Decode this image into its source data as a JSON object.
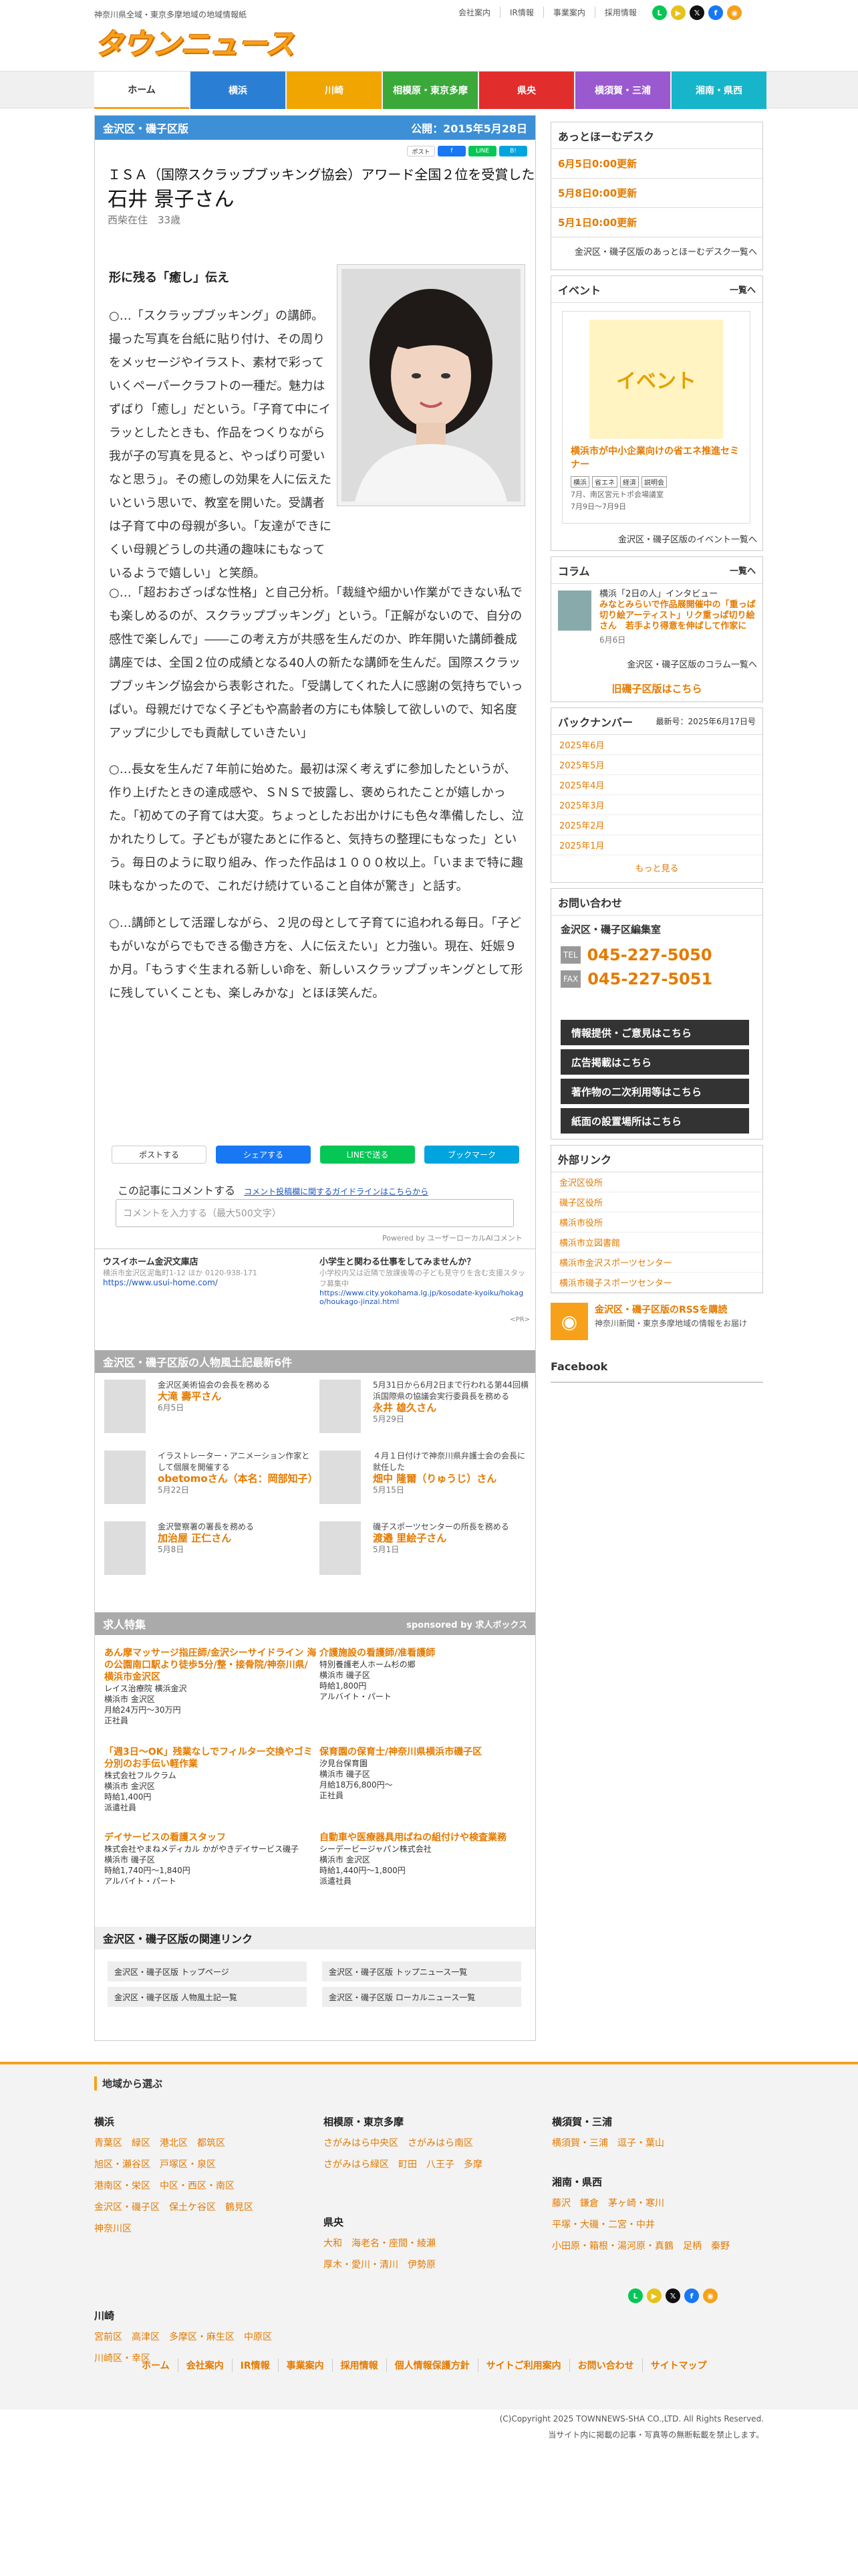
{
  "header": {
    "tagline": "神奈川県全域・東京多摩地域の地域情報紙",
    "logo": "タウンニュース",
    "top_links": [
      "会社案内",
      "IR情報",
      "事業案内",
      "採用情報"
    ],
    "social_icons": [
      "line-icon",
      "youtube-icon",
      "x-icon",
      "facebook-icon",
      "rss-icon"
    ]
  },
  "nav": {
    "tabs": [
      {
        "label": "ホーム",
        "color": "#ffffff",
        "text": "#333333"
      },
      {
        "label": "横浜",
        "color": "#2a7fd4",
        "text": "#ffffff"
      },
      {
        "label": "川崎",
        "color": "#f0a500",
        "text": "#ffffff"
      },
      {
        "label": "相模原・東京多摩",
        "color": "#3aa93a",
        "text": "#ffffff"
      },
      {
        "label": "県央",
        "color": "#e22d2d",
        "text": "#ffffff"
      },
      {
        "label": "横須賀・三浦",
        "color": "#9b59d0",
        "text": "#ffffff"
      },
      {
        "label": "湘南・県西",
        "color": "#17b5c9",
        "text": "#ffffff"
      }
    ]
  },
  "article": {
    "region": "金沢区・磯子区版",
    "published": "公開：2015年5月28日",
    "share_mini": [
      "ポスト",
      "f",
      "LINE",
      "B!"
    ],
    "subtitle": "ＩＳＡ（国際スクラップブッキング協会）アワード全国２位を受賞した",
    "name": "石井 景子さん",
    "meta": "西柴在住　33歳",
    "section_title": "形に残る「癒し」伝え",
    "paragraphs": [
      "○…「スクラップブッキング」の講師。撮った写真を台紙に貼り付け、その周りをメッセージやイラスト、素材で彩っていくペーパークラフトの一種だ。魅力はずばり「癒し」だという。「子育て中にイラッとしたときも、作品をつくりながら我が子の写真を見ると、やっぱり可愛いなと思う」。その癒しの効果を人に伝えたいという思いで、教室を開いた。受講者は子育て中の母親が多い。「友達ができにくい母親どうしの共通の趣味にもなっているようで嬉しい」と笑顔。",
      "○…「超おおざっぱな性格」と自己分析。「裁縫や細かい作業ができない私でも楽しめるのが、スクラップブッキング」という。「正解がないので、自分の感性で楽しんで」――この考え方が共感を生んだのか、昨年開いた講師養成講座では、全国２位の成績となる40人の新たな講師を生んだ。国際スクラップブッキング協会から表彰された。「受講してくれた人に感謝の気持ちでいっぱい。母親だけでなく子どもや高齢者の方にも体験して欲しいので、知名度アップに少しでも貢献していきたい」",
      "○…長女を生んだ７年前に始めた。最初は深く考えずに参加したというが、作り上げたときの達成感や、ＳＮＳで披露し、褒められたことが嬉しかった。「初めての子育ては大変。ちょっとしたお出かけにも色々準備したし、泣かれたりして。子どもが寝たあとに作ると、気持ちの整理にもなった」という。毎日のように取り組み、作った作品は１０００枚以上。「いままで特に趣味もなかったので、これだけ続けていること自体が驚き」と話す。",
      "○…講師として活躍しながら、２児の母として子育てに追われる毎日。「子どもがいながらでもできる働き方を、人に伝えたい」と力強い。現在、妊娠９か月。「もうすぐ生まれる新しい命を、新しいスクラップブッキングとして形に残していくことも、楽しみかな」とほほ笑んだ。"
    ],
    "share_buttons": [
      {
        "label": "ポストする",
        "color": "#ffffff",
        "text": "#333333"
      },
      {
        "label": "シェアする",
        "color": "#1877f2",
        "text": "#ffffff"
      },
      {
        "label": "LINEで送る",
        "color": "#06c755",
        "text": "#ffffff"
      },
      {
        "label": "ブックマーク",
        "color": "#00a4de",
        "text": "#ffffff"
      }
    ],
    "comment_label": "この記事にコメントする",
    "comment_guide": "コメント投稿欄に関するガイドラインはこちらから",
    "comment_placeholder": "コメントを入力する（最大500文字）",
    "powered_by": "Powered by ユーザーローカルAIコメント"
  },
  "ads": [
    {
      "title": "ウスイホーム金沢文庫店",
      "sub": "横浜市金沢区泥亀町1-12 ほか 0120-938-171",
      "url": "https://www.usui-home.com/"
    },
    {
      "title": "小学生と関わる仕事をしてみませんか？",
      "sub": "小学校内又は近隣で放課後等の子ども見守りを含む支援スタッフ募集中",
      "url": "https://www.city.yokohama.lg.jp/kosodate-kyoiku/hokago/houkago-jinzai.html"
    }
  ],
  "ads_pr": "<PR>",
  "people": {
    "header": "金沢区・磯子区版の人物風土記最新6件",
    "items": [
      {
        "desc": "金沢区美術協会の会長を務める",
        "name": "大滝 壽平さん",
        "date": "6月5日"
      },
      {
        "desc": "5月31日から6月2日まで行われる第44回横浜国際県の協議会実行委員長を務める",
        "name": "永井 雄久さん",
        "date": "5月29日"
      },
      {
        "desc": "イラストレーター・アニメーション作家として個展を開催する",
        "name": "obetomoさん（本名：岡部知子）",
        "date": "5月22日"
      },
      {
        "desc": "４月１日付けで神奈川県弁護士会の会長に就任した",
        "name": "畑中 隆爾（りゅうじ）さん",
        "date": "5月15日"
      },
      {
        "desc": "金沢警察署の署長を務める",
        "name": "加治屋 正仁さん",
        "date": "5月8日"
      },
      {
        "desc": "磯子スポーツセンターの所長を務める",
        "name": "渡邉 里絵子さん",
        "date": "5月1日"
      }
    ]
  },
  "jobs": {
    "header": "求人特集",
    "sponsor": "sponsored by 求人ボックス",
    "items": [
      {
        "title": "あん摩マッサージ指圧師/金沢シーサイドライン 海の公園南口駅より徒歩5分/整・接骨院/神奈川県/横浜市金沢区",
        "co": "レイス治療院 横浜金沢",
        "loc": "横浜市 金沢区",
        "pay": "月給24万円～30万円",
        "type": "正社員"
      },
      {
        "title": "介護施設の看護師/准看護師",
        "co": "特別養護老人ホーム杉の郷",
        "loc": "横浜市 磯子区",
        "pay": "時給1,800円",
        "type": "アルバイト・パート"
      },
      {
        "title": "「週3日～OK」残業なしでフィルター交換やゴミ分別のお手伝い軽作業",
        "co": "株式会社フルクラム",
        "loc": "横浜市 金沢区",
        "pay": "時給1,400円",
        "type": "派遣社員"
      },
      {
        "title": "保育園の保育士/神奈川県横浜市磯子区",
        "co": "汐見台保育園",
        "loc": "横浜市 磯子区",
        "pay": "月給18万6,800円～",
        "type": "正社員"
      },
      {
        "title": "デイサービスの看護スタッフ",
        "co": "株式会社やまねメディカル かがやきデイサービス磯子",
        "loc": "横浜市 磯子区",
        "pay": "時給1,740円～1,840円",
        "type": "アルバイト・パート"
      },
      {
        "title": "自動車や医療器具用ばねの組付けや検査業務",
        "co": "シーデービージャパン株式会社",
        "loc": "横浜市 金沢区",
        "pay": "時給1,440円～1,800円",
        "type": "派遣社員"
      }
    ]
  },
  "related": {
    "header": "金沢区・磯子区版の関連リンク",
    "links": [
      "金沢区・磯子区版 トップページ",
      "金沢区・磯子区版 トップニュース一覧",
      "金沢区・磯子区版 人物風土記一覧",
      "金沢区・磯子区版 ローカルニュース一覧"
    ]
  },
  "sidebar": {
    "desk_header": "あっとほーむデスク",
    "desk_items": [
      "6月5日0:00更新",
      "5月8日0:00更新",
      "5月1日0:00更新"
    ],
    "desk_more": "金沢区・磯子区版のあっとほーむデスク一覧へ",
    "event_header": "イベント",
    "event_more_top": "一覧へ",
    "event_card_label": "イベント",
    "event_title": "横浜市が中小企業向けの省エネ推進セミナー",
    "event_tags": [
      "横浜",
      "省エネ",
      "経済",
      "説明会"
    ],
    "event_place": "7月、南区宮元トポ会場議室",
    "event_dates": "7月9日～7月9日",
    "event_more": "金沢区・磯子区版のイベント一覧へ",
    "column_header": "コラム",
    "column_more_top": "一覧へ",
    "column_title_a": "横浜「2日の人」インタビュー",
    "column_title_b": "みなとみらいで作品展開催中の「重っぱ切り絵アーティスト」リク重っぱ切り絵さん　若手より得意を伸ばして作家に",
    "column_date": "6月6日",
    "column_more": "金沢区・磯子区版のコラム一覧へ",
    "old_issue": "旧磯子区版はこちら",
    "backnumber_header": "バックナンバー",
    "backnumber_updated": "最新号：2025年6月17日号",
    "backnumbers": [
      "2025年6月",
      "2025年5月",
      "2025年4月",
      "2025年3月",
      "2025年2月",
      "2025年1月"
    ],
    "backnumber_more": "もっと見る",
    "contact_header": "お問い合わせ",
    "contact_office": "金沢区・磯子区編集室",
    "tel_label": "TEL",
    "tel": "045-227-5050",
    "fax_label": "FAX",
    "fax": "045-227-5051",
    "contact_buttons": [
      "情報提供・ご意見はこちら",
      "広告掲載はこちら",
      "著作物の二次利用等はこちら",
      "紙面の設置場所はこちら"
    ],
    "links_header": "外部リンク",
    "ext_links": [
      "金沢区役所",
      "磯子区役所",
      "横浜市役所",
      "横浜市立図書館",
      "横浜市金沢スポーツセンター",
      "横浜市磯子スポーツセンター"
    ],
    "rss_title": "金沢区・磯子区版のRSSを購読",
    "rss_desc": "神奈川新聞・東京多摩地域の情報をお届け",
    "facebook_header": "Facebook"
  },
  "footer": {
    "title": "地域から選ぶ",
    "cols": [
      {
        "head": "横浜",
        "rows": [
          "青葉区　緑区　港北区　都筑区",
          "旭区・瀬谷区　戸塚区・泉区",
          "港南区・栄区　中区・西区・南区",
          "金沢区・磯子区　保土ケ谷区　鶴見区",
          "神奈川区"
        ]
      },
      {
        "head": "川崎",
        "rows": [
          "宮前区　高津区　多摩区・麻生区　中原区",
          "川崎区・幸区"
        ]
      },
      {
        "head": "相模原・東京多摩",
        "rows": [
          "さがみはら中央区　さがみはら南区",
          "さがみはら緑区　町田　八王子　多摩"
        ]
      },
      {
        "head": "県央",
        "rows": [
          "大和　海老名・座間・綾瀬",
          "厚木・愛川・清川　伊勢原"
        ]
      },
      {
        "head": "横須賀・三浦",
        "rows": [
          "横須賀・三浦　逗子・葉山"
        ]
      },
      {
        "head": "湘南・県西",
        "rows": [
          "藤沢　鎌倉　茅ヶ崎・寒川",
          "平塚・大磯・二宮・中井",
          "小田原・箱根・湯河原・真鶴　足柄　秦野"
        ]
      }
    ],
    "nav": [
      "ホーム",
      "会社案内",
      "IR情報",
      "事業案内",
      "採用情報",
      "個人情報保護方針",
      "サイトご利用案内",
      "お問い合わせ",
      "サイトマップ"
    ],
    "copyright": "(C)Copyright 2025 TOWNNEWS-SHA CO.,LTD. All Rights Reserved.",
    "notice": "当サイト内に掲載の記事・写真等の無断転載を禁止します。"
  }
}
